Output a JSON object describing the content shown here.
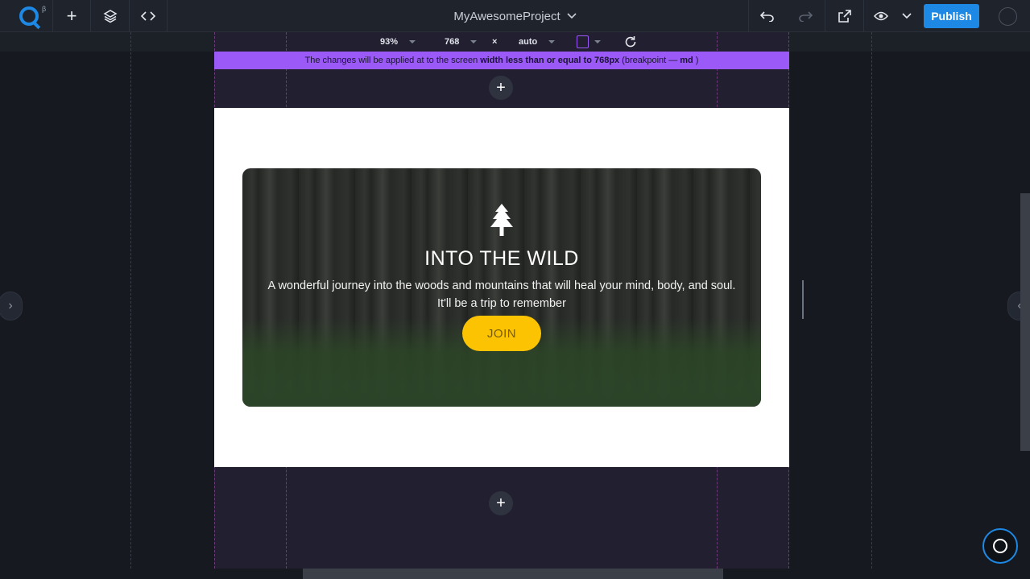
{
  "toolbar": {
    "logo_beta": "β",
    "project_name": "MyAwesomeProject",
    "publish_label": "Publish"
  },
  "responsive": {
    "zoom": "93%",
    "width": "768",
    "times": "×",
    "height": "auto"
  },
  "breakpoint_notice": {
    "prefix": "The changes will be applied at to the screen",
    "bold": "width less than or equal to 768px",
    "suffix_open": "(breakpoint —",
    "bp": "md",
    "suffix_close": ")"
  },
  "hero": {
    "title": "INTO THE WILD",
    "description_line1": "A wonderful journey into the woods and mountains that will heal your mind, body, and soul.",
    "description_line2": "It'll be a trip to remember",
    "button_label": "JOIN"
  },
  "colors": {
    "accent": "#1e88e5",
    "breakpoint_bar": "#9b59f7",
    "join_button": "#fcc303"
  }
}
